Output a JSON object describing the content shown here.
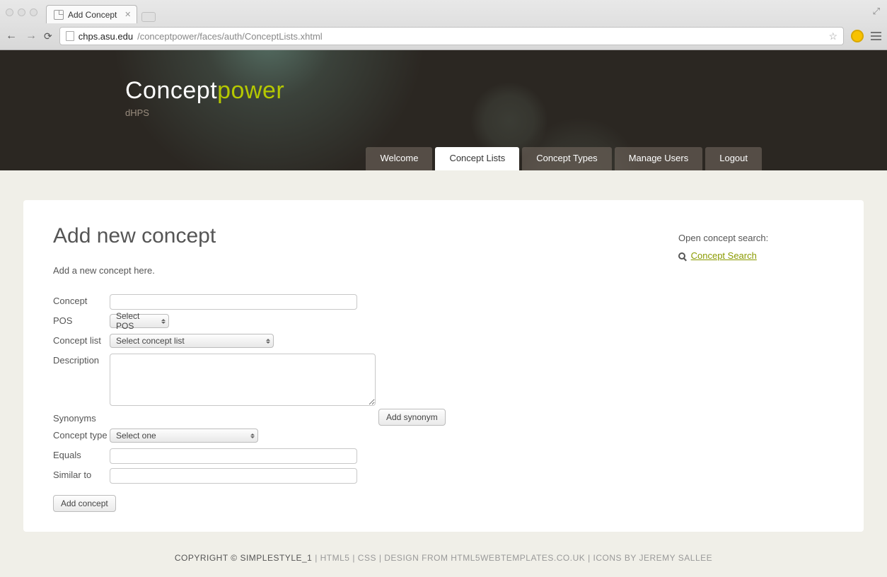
{
  "browser": {
    "tab_title": "Add Concept",
    "url_host": "chps.asu.edu",
    "url_path": "/conceptpower/faces/auth/ConceptLists.xhtml"
  },
  "header": {
    "logo_part1": "Concept",
    "logo_part2": "power",
    "sublogo": "dHPS",
    "nav": {
      "welcome": "Welcome",
      "concept_lists": "Concept Lists",
      "concept_types": "Concept Types",
      "manage_users": "Manage Users",
      "logout": "Logout"
    }
  },
  "page": {
    "title": "Add new concept",
    "intro": "Add a new concept here.",
    "labels": {
      "concept": "Concept",
      "pos": "POS",
      "concept_list": "Concept list",
      "description": "Description",
      "synonyms": "Synonyms",
      "concept_type": "Concept type",
      "equals": "Equals",
      "similar_to": "Similar to"
    },
    "selects": {
      "pos": "Select POS",
      "concept_list": "Select concept list",
      "concept_type": "Select one"
    },
    "buttons": {
      "add_synonym": "Add synonym",
      "add_concept": "Add concept"
    }
  },
  "sidebar": {
    "title": "Open concept search:",
    "link": "Concept Search"
  },
  "footer": {
    "copyright": "COPYRIGHT © SIMPLESTYLE_1",
    "sep": " | ",
    "html5": "HTML5",
    "css": "CSS",
    "design": "DESIGN FROM HTML5WEBTEMPLATES.CO.UK",
    "icons": "ICONS BY JEREMY SALLEE"
  }
}
